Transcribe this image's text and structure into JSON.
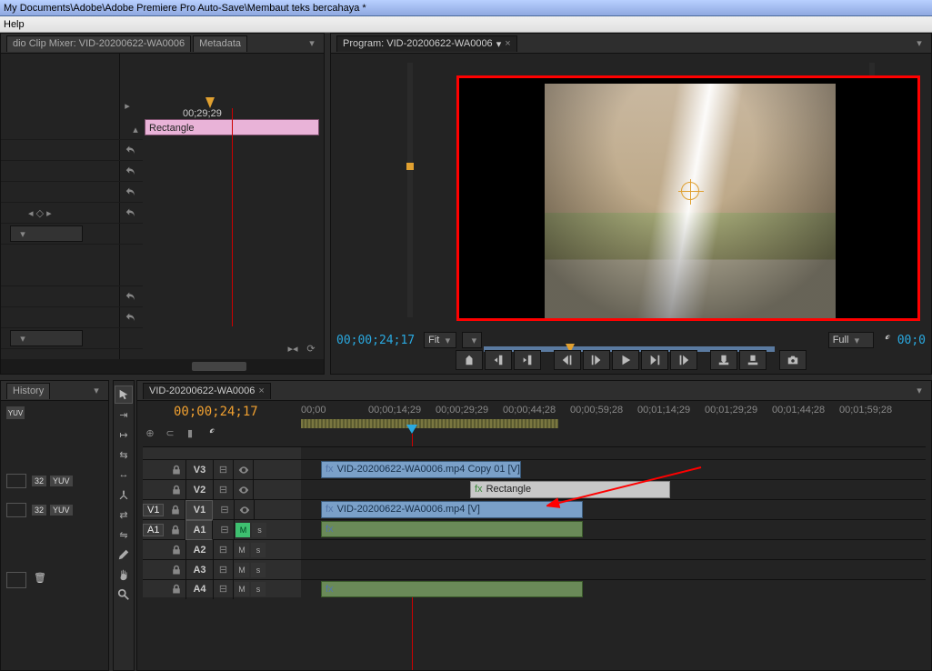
{
  "titlebar": "My Documents\\Adobe\\Adobe Premiere Pro Auto-Save\\Membaut teks bercahaya *",
  "menubar": {
    "help": "Help"
  },
  "fx": {
    "tab_mixer": "dio Clip Mixer: VID-20200622-WA0006",
    "tab_meta": "Metadata",
    "ruler_tc": "00;29;29",
    "clip_name": "Rectangle"
  },
  "program": {
    "tab": "Program: VID-20200622-WA0006",
    "tc_left": "00;00;24;17",
    "fit": "Fit",
    "full": "Full",
    "tc_right": "00;0"
  },
  "history": {
    "tab_hist": "History",
    "badges": [
      "32",
      "YUV",
      "32",
      "YUV"
    ]
  },
  "timeline": {
    "tab": "VID-20200622-WA0006",
    "tc": "00;00;24;17",
    "ruler": [
      "00;00",
      "00;00;14;29",
      "00;00;29;29",
      "00;00;44;28",
      "00;00;59;28",
      "00;01;14;29",
      "00;01;29;29",
      "00;01;44;28",
      "00;01;59;28"
    ],
    "v3": {
      "label": "V3",
      "clip": "VID-20200622-WA0006.mp4 Copy 01 [V]"
    },
    "v2": {
      "label": "V2",
      "clip": "Rectangle"
    },
    "v1": {
      "tgt": "V1",
      "label": "V1",
      "clip": "VID-20200622-WA0006.mp4 [V]"
    },
    "a1": {
      "tgt": "A1",
      "label": "A1",
      "m": "M",
      "s": "s"
    },
    "a2": {
      "label": "A2",
      "m": "M",
      "s": "s"
    },
    "a3": {
      "label": "A3",
      "m": "M",
      "s": "s"
    },
    "a4": {
      "label": "A4",
      "m": "M",
      "s": "s"
    },
    "fx": "fx"
  }
}
